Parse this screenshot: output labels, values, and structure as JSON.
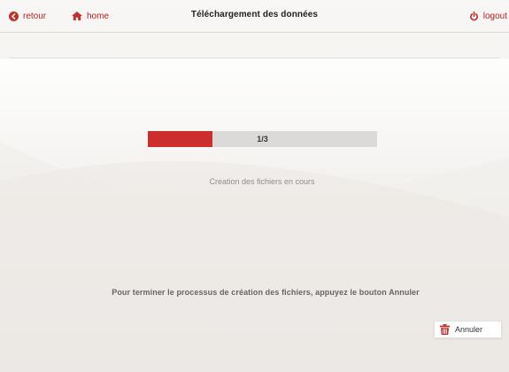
{
  "header": {
    "back_label": "retour",
    "home_label": "home",
    "title": "Téléchargement des données",
    "logout_label": "logout"
  },
  "progress": {
    "label": "1/3",
    "current": 1,
    "total": 3,
    "fill_fraction": 0.28,
    "fill_color": "#cd2e2d"
  },
  "status": {
    "text": "Creation des fichiers en cours"
  },
  "instruction": {
    "text": "Pour terminer le processus de création des fichiers, appuyez le bouton Annuler"
  },
  "cancel": {
    "label": "Annuler",
    "icon": "trash-icon"
  },
  "colors": {
    "accent": "#b5211f",
    "background": "#f3f1ee"
  }
}
